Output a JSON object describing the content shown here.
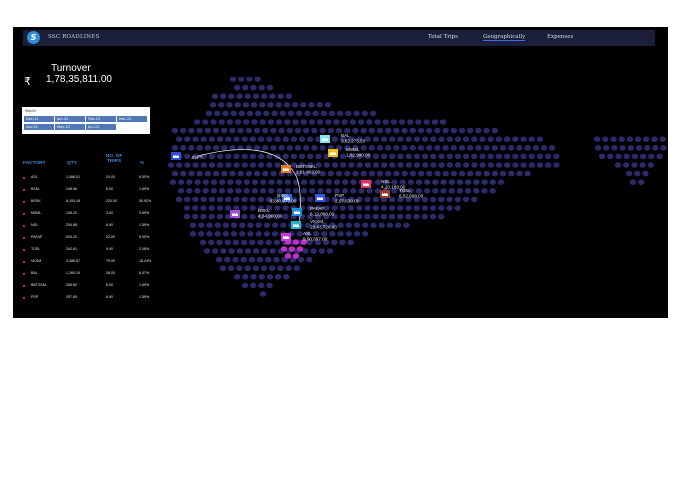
{
  "topbar": {
    "logo_char": "S",
    "brand": "SSC ROADLINES",
    "tabs": [
      {
        "label": "Total Trips",
        "active": false
      },
      {
        "label": "Geographically",
        "active": true
      },
      {
        "label": "Expenses",
        "active": false
      }
    ]
  },
  "turnover": {
    "symbol": "₹",
    "label": "Turnover",
    "value": "1,78,35,811.00"
  },
  "slicer": {
    "title": "Month",
    "months": [
      "Dec-21",
      "Jan-22",
      "Feb-22",
      "Mar-22",
      "Apr-22",
      "May-22",
      "Jun-22"
    ]
  },
  "table": {
    "headers": {
      "factory": "FACTORY",
      "qty": "QTY.",
      "trips": "NO. OF TRIPS",
      "pct": "%"
    },
    "rows": [
      {
        "factory": "ASL",
        "qty": "1,088.01",
        "trips": "24.00",
        "pct": "6.00%"
      },
      {
        "factory": "BSKL",
        "qty": "248.56",
        "trips": "6.00",
        "pct": "1.59%"
      },
      {
        "factory": "BSSK",
        "qty": "8,153.18",
        "trips": "220.00",
        "pct": "50.92%"
      },
      {
        "factory": "MSML",
        "qty": "126.20",
        "trips": "3.00",
        "pct": "0.69%"
      },
      {
        "factory": "NSL",
        "qty": "254.88",
        "trips": "6.00",
        "pct": "1.59%"
      },
      {
        "factory": "PAFAP",
        "qty": "903.20",
        "trips": "22.00",
        "pct": "5.00%"
      },
      {
        "factory": "TOSL",
        "qty": "342.61",
        "trips": "9.00",
        "pct": "2.08%"
      },
      {
        "factory": "VKSM",
        "qty": "3,385.57",
        "trips": "79.00",
        "pct": "18.24%"
      },
      {
        "factory": "BAL",
        "qty": "1,160.19",
        "trips": "28.00",
        "pct": "6.47%"
      },
      {
        "factory": "BBTSSKL",
        "qty": "255.82",
        "trips": "6.00",
        "pct": "1.59%"
      },
      {
        "factory": "PSP",
        "qty": "257.65",
        "trips": "6.00",
        "pct": "1.59%"
      }
    ]
  },
  "map": {
    "hex_color": "#2b2a6b",
    "origin": {
      "name": "JNPT",
      "color": "#2d4fd6"
    },
    "factories": [
      {
        "name": "BAL",
        "value": "3,82,275.50",
        "color": "#7fe3ef"
      },
      {
        "name": "MSML",
        "value": "1,92,990.00",
        "color": "#f2c200"
      },
      {
        "name": "BBTSSKL",
        "value": "2,81,402.00",
        "color": "#ea7b1c"
      },
      {
        "name": "NSL",
        "value": "4,20,189.00",
        "color": "#e8306b"
      },
      {
        "name": "TOSL",
        "value": "6,52,698.00",
        "color": "#9a3a2a"
      },
      {
        "name": "PSP",
        "value": "2,57,630.00",
        "color": "#3155e6"
      },
      {
        "name": "BSKL",
        "value": "83,40,972.00",
        "color": "#3468e8"
      },
      {
        "name": "BSKL",
        "value": "4,34,980.00",
        "color": "#a64dd8"
      },
      {
        "name": "PAFAP",
        "value": "8,12,880.00",
        "color": "#1f8fd6"
      },
      {
        "name": "VKSM",
        "value": "29,43,726.00",
        "color": "#23b5c8"
      },
      {
        "name": "ASL",
        "value": "9,90,697.00",
        "color": "#c93ad6"
      }
    ]
  }
}
